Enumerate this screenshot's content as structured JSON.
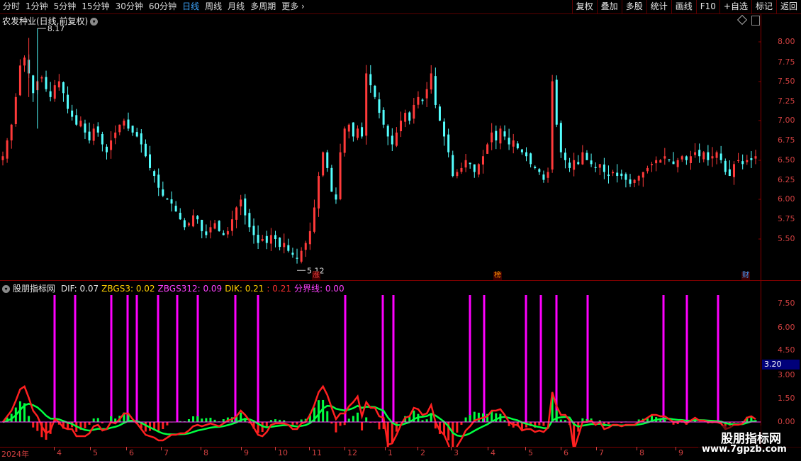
{
  "toolbar": {
    "periods": [
      "分时",
      "1分钟",
      "5分钟",
      "15分钟",
      "30分钟",
      "60分钟",
      "日线",
      "周线",
      "月线",
      "多周期",
      "更多"
    ],
    "active_period": "日线",
    "right_buttons": [
      "复权",
      "叠加",
      "多股",
      "统计",
      "画线",
      "F10",
      "+自选",
      "标记",
      "返回"
    ]
  },
  "main_chart": {
    "title": "农发种业(日线,前复权)",
    "y_ticks": [
      "8.00",
      "7.75",
      "7.50",
      "7.25",
      "7.00",
      "6.75",
      "6.50",
      "6.25",
      "6.00",
      "5.75",
      "5.50"
    ],
    "high_label": "8.17",
    "low_label": "5.12",
    "markers": [
      {
        "text": "涨",
        "color": "#ff4040"
      },
      {
        "text": "榜",
        "color": "#ff9000"
      },
      {
        "text": "财",
        "color": "#40a0ff"
      }
    ]
  },
  "indicator": {
    "name": "股朋指标网",
    "legend": [
      {
        "label": "DIF: 0.07",
        "color": "#e6e6e6"
      },
      {
        "label": "ZBGS3: 0.02",
        "color": "#ffd000"
      },
      {
        "label": "ZBGS312: 0.09",
        "color": "#ff40ff"
      },
      {
        "label": "DIK: 0.21",
        "color": "#ffd000"
      },
      {
        "label": ": 0.21",
        "color": "#ff3030"
      },
      {
        "label": "分界线: 0.00",
        "color": "#ff40ff"
      }
    ],
    "y_ticks": [
      "7.50",
      "6.00",
      "4.50",
      "3.00",
      "1.50",
      "0.00"
    ],
    "current_value": "3.20"
  },
  "x_axis": {
    "labels": [
      "2024年",
      "4",
      "5",
      "6",
      "7",
      "8",
      "9",
      "10",
      "11",
      "12",
      "1",
      "2",
      "3",
      "4",
      "5",
      "6",
      "7",
      "8",
      "9"
    ]
  },
  "watermark": {
    "title": "股朋指标网",
    "url": "www.7gpzb.com"
  },
  "colors": {
    "up": "#ff3a3a",
    "down": "#54ffff",
    "signal": "#ff00ff",
    "green": "#00ff40",
    "red": "#ff2020"
  },
  "chart_data": {
    "type": "candlestick",
    "title": "农发种业(日线,前复权)",
    "price_range": [
      5.1,
      8.2
    ],
    "closes": [
      6.55,
      6.75,
      6.95,
      7.3,
      7.7,
      7.8,
      7.6,
      7.35,
      7.5,
      7.55,
      7.4,
      7.3,
      7.45,
      7.5,
      7.35,
      7.15,
      7.05,
      6.95,
      7.0,
      6.85,
      6.75,
      6.9,
      6.85,
      6.7,
      6.6,
      6.75,
      6.85,
      6.95,
      7.0,
      6.9,
      6.85,
      6.8,
      6.7,
      6.55,
      6.4,
      6.3,
      6.15,
      6.05,
      6.0,
      5.95,
      5.85,
      5.75,
      5.65,
      5.7,
      5.8,
      5.75,
      5.6,
      5.55,
      5.65,
      5.7,
      5.6,
      5.55,
      5.6,
      5.75,
      5.9,
      6.0,
      5.8,
      5.65,
      5.55,
      5.45,
      5.5,
      5.45,
      5.55,
      5.5,
      5.4,
      5.45,
      5.35,
      5.3,
      5.25,
      5.35,
      5.45,
      5.6,
      5.9,
      6.3,
      6.6,
      6.4,
      6.1,
      6.0,
      6.6,
      6.9,
      6.95,
      6.8,
      6.9,
      6.8,
      7.6,
      7.45,
      7.3,
      7.1,
      6.95,
      6.8,
      6.7,
      6.85,
      7.0,
      7.1,
      7.0,
      7.2,
      7.3,
      7.25,
      7.4,
      7.6,
      7.2,
      7.0,
      6.8,
      6.6,
      6.3,
      6.35,
      6.4,
      6.5,
      6.45,
      6.35,
      6.45,
      6.55,
      6.7,
      6.85,
      6.75,
      6.9,
      6.8,
      6.7,
      6.75,
      6.65,
      6.6,
      6.55,
      6.45,
      6.4,
      6.35,
      6.25,
      6.35,
      7.5,
      6.95,
      6.6,
      6.5,
      6.4,
      6.5,
      6.45,
      6.6,
      6.5,
      6.45,
      6.4,
      6.45,
      6.35,
      6.3,
      6.35,
      6.3,
      6.3,
      6.25,
      6.2,
      6.25,
      6.3,
      6.35,
      6.4,
      6.45,
      6.5,
      6.5,
      6.55,
      6.5,
      6.45,
      6.5,
      6.55,
      6.5,
      6.55,
      6.6,
      6.55,
      6.6,
      6.5,
      6.55,
      6.6,
      6.5,
      6.35,
      6.3,
      6.45,
      6.5,
      6.45,
      6.5,
      6.5,
      6.55
    ],
    "events": [
      {
        "label": "8.17",
        "type": "high"
      },
      {
        "label": "5.12",
        "type": "low"
      }
    ]
  }
}
